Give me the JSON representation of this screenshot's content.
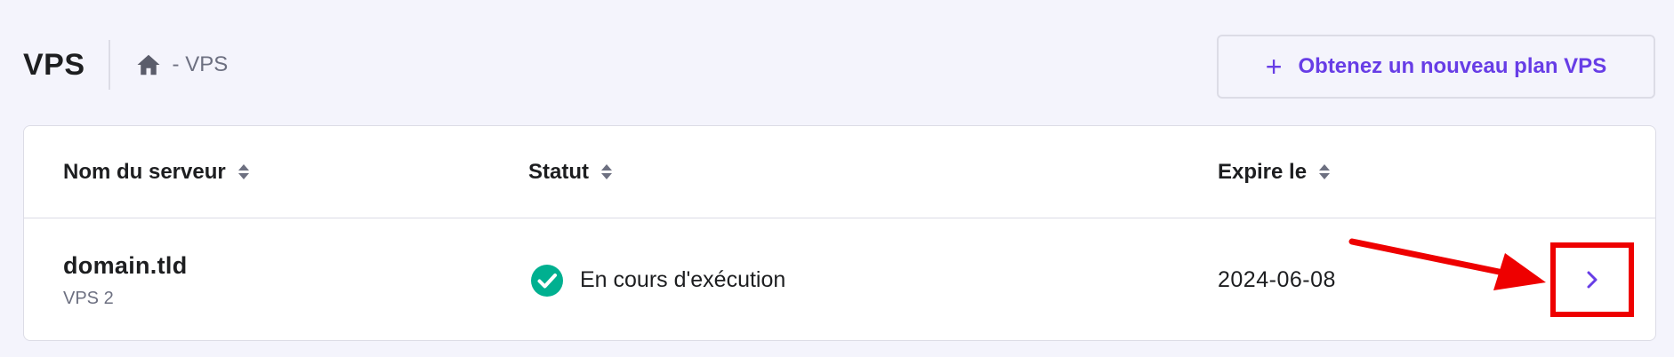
{
  "header": {
    "title": "VPS",
    "breadcrumb": {
      "home_icon": "home-icon",
      "current": "- VPS"
    },
    "new_plan_button": {
      "icon": "plus-icon",
      "label": "Obtenez un nouveau plan VPS"
    }
  },
  "table": {
    "columns": [
      {
        "label": "Nom du serveur",
        "icon": "sort-icon"
      },
      {
        "label": "Statut",
        "icon": "sort-icon"
      },
      {
        "label": "Expire le",
        "icon": "sort-icon"
      }
    ],
    "rows": [
      {
        "server_name": "domain.tld",
        "plan": "VPS 2",
        "status": "En cours d'exécution",
        "status_icon": "check-circle-icon",
        "expires": "2024-06-08",
        "action_icon": "chevron-right-icon"
      }
    ]
  },
  "colors": {
    "accent": "#673de6",
    "status_success": "#00b090",
    "annotation": "#ee0000",
    "background": "#f4f4fc"
  }
}
